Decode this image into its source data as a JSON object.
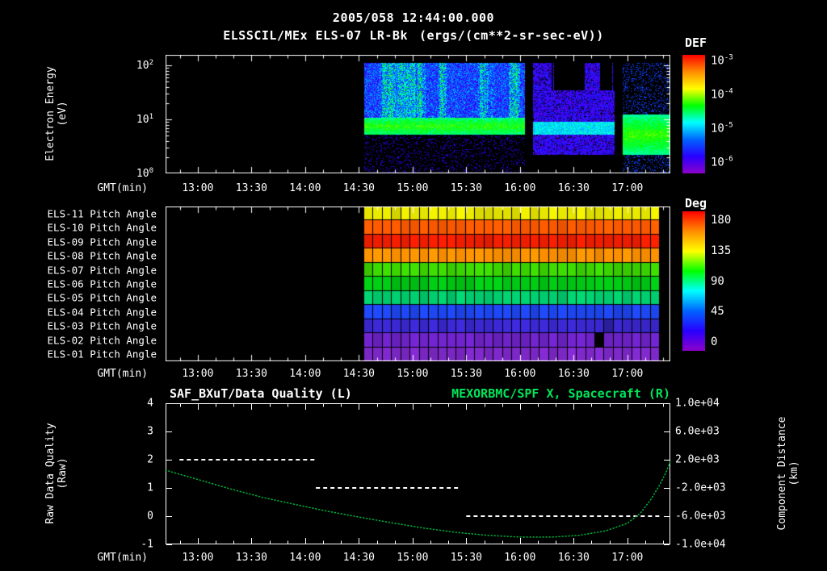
{
  "colors": {
    "background": "#000000",
    "text": "#ffffff",
    "accent_green": "#00e65a",
    "curve_green": "#00a838",
    "quality_white": "#ffffff",
    "rainbow": [
      "#ff0000",
      "#ff8c00",
      "#ffff00",
      "#00ff00",
      "#00ffff",
      "#0064ff",
      "#2800ff",
      "#8c00c8"
    ]
  },
  "header": {
    "timestamp": "2005/058 12:44:00.000",
    "instrument": "ELSSCIL/MEx ELS-07 LR-Bk",
    "units": "(ergs/(cm**2-sr-sec-eV))"
  },
  "time_axis": {
    "label": "GMT(min)",
    "start_hour": 12.7,
    "end_hour": 17.4,
    "ticks": [
      {
        "label": "13:00",
        "hour": 13.0
      },
      {
        "label": "13:30",
        "hour": 13.5
      },
      {
        "label": "14:00",
        "hour": 14.0
      },
      {
        "label": "14:30",
        "hour": 14.5
      },
      {
        "label": "15:00",
        "hour": 15.0
      },
      {
        "label": "15:30",
        "hour": 15.5
      },
      {
        "label": "16:00",
        "hour": 16.0
      },
      {
        "label": "16:30",
        "hour": 16.5
      },
      {
        "label": "17:00",
        "hour": 17.0
      }
    ],
    "minor_step_min": 10
  },
  "spectrogram_panel": {
    "ylabel": [
      "Electron Energy",
      "(eV)"
    ],
    "top_logE": 2.2,
    "yticks": [
      {
        "base": "10",
        "exp": "2",
        "logE": 2
      },
      {
        "base": "10",
        "exp": "1",
        "logE": 1
      },
      {
        "base": "10",
        "exp": "0",
        "logE": 0
      }
    ],
    "colorbar": {
      "title": "DEF",
      "ticks": [
        {
          "base": "10",
          "exp": "-3"
        },
        {
          "base": "10",
          "exp": "-4"
        },
        {
          "base": "10",
          "exp": "-5"
        },
        {
          "base": "10",
          "exp": "-6"
        }
      ]
    }
  },
  "pitch_panel": {
    "columns": 32,
    "data_start_hour": 14.55,
    "data_end_hour": 17.3,
    "rows": [
      {
        "label": "ELS-11 Pitch Angle",
        "color": "#e6e600",
        "deg": 125
      },
      {
        "label": "ELS-10 Pitch Angle",
        "color": "#ff5a00",
        "deg": 155
      },
      {
        "label": "ELS-09 Pitch Angle",
        "color": "#f01e00",
        "deg": 168
      },
      {
        "label": "ELS-08 Pitch Angle",
        "color": "#ff9100",
        "deg": 142
      },
      {
        "label": "ELS-07 Pitch Angle",
        "color": "#3cd400",
        "deg": 98
      },
      {
        "label": "ELS-06 Pitch Angle",
        "color": "#00c814",
        "deg": 88
      },
      {
        "label": "ELS-05 Pitch Angle",
        "color": "#00cd6e",
        "deg": 72
      },
      {
        "label": "ELS-04 Pitch Angle",
        "color": "#1e46f0",
        "deg": 48
      },
      {
        "label": "ELS-03 Pitch Angle",
        "color": "#3c28d2",
        "deg": 32
      },
      {
        "label": "ELS-02 Pitch Angle",
        "color": "#6e23c8",
        "deg": 18
      },
      {
        "label": "ELS-01 Pitch Angle",
        "color": "#7d28c8",
        "deg": 12
      }
    ],
    "special_cells": [
      {
        "row": 9,
        "col": 25,
        "color": "#000000"
      },
      {
        "row": 8,
        "col": 26,
        "color": "#2a1e9b"
      }
    ],
    "colorbar": {
      "title": "Deg",
      "ticks": [
        "180",
        "135",
        "90",
        "45",
        "0"
      ]
    }
  },
  "bottom_panel": {
    "title_left": "SAF_BXuT/Data Quality (L)",
    "title_right": "MEXORBMC/SPF X, Spacecraft (R)",
    "ylabel_left": [
      "Raw Data Quality",
      "(Raw)"
    ],
    "ylabel_right": [
      "Component Distance",
      "(km)"
    ],
    "yticks_left": [
      "4",
      "3",
      "2",
      "1",
      "0",
      "-1"
    ],
    "yticks_right": [
      "1.0e+04",
      "6.0e+03",
      "2.0e+03",
      "-2.0e+03",
      "-6.0e+03",
      "-1.0e+04"
    ],
    "y_range": [
      -1,
      4
    ]
  },
  "chart_data": [
    {
      "type": "heatmap",
      "name": "electron-energy-spectrogram",
      "title": "ELSSCIL/MEx ELS-07 LR-Bk",
      "units": "ergs/(cm**2-sr-sec-eV)",
      "xlabel": "GMT(min)",
      "x_ticks": [
        "13:00",
        "13:30",
        "14:00",
        "14:30",
        "15:00",
        "15:30",
        "16:00",
        "16:30",
        "17:00"
      ],
      "x_range_hours": [
        12.7,
        17.4
      ],
      "ylabel": "Electron Energy (eV)",
      "y_scale": "log",
      "y_range_eV": [
        1,
        160
      ],
      "colorbar": {
        "label": "DEF",
        "min": 1e-06,
        "max": 0.001
      },
      "data_start_hour": 14.55,
      "features": {
        "band_logE": [
          0.72,
          1.04
        ],
        "band_bright_until_hour": 16.04,
        "dim_zone_hours": [
          16.12,
          16.88
        ],
        "gaps_hours": [
          [
            16.04,
            16.12
          ],
          [
            16.88,
            16.95
          ]
        ],
        "right_blob": {
          "from_hour": 16.95,
          "logE": [
            0.35,
            1.1
          ]
        },
        "description": "No data before ~14:33. Diffuse blue 10-100 eV flux with bright cyan vertical bursts 14:33-16:00, persistent bright green band near 5-10 eV, faint purple flux with black dropouts 16:05-16:55, bright green patch ~3-13 eV after ~16:55 to end."
      }
    },
    {
      "type": "heatmap",
      "name": "pitch-angle-grid",
      "x_range_hours": [
        14.55,
        17.3
      ],
      "rows": [
        "ELS-11",
        "ELS-10",
        "ELS-09",
        "ELS-08",
        "ELS-07",
        "ELS-06",
        "ELS-05",
        "ELS-04",
        "ELS-03",
        "ELS-02",
        "ELS-01"
      ],
      "values_deg": [
        125,
        155,
        168,
        142,
        98,
        88,
        72,
        48,
        32,
        18,
        12
      ],
      "colorbar": {
        "label": "Deg",
        "min": 0,
        "max": 180
      },
      "anomalies": [
        {
          "sensor": "ELS-02",
          "hour": 16.95,
          "note": "black (missing) cell"
        }
      ]
    },
    {
      "type": "line",
      "name": "data-quality-and-spacecraft-x",
      "left_axis": {
        "label": "Raw Data Quality (Raw)",
        "range": [
          -1,
          4
        ]
      },
      "right_axis": {
        "label": "Component Distance (km)",
        "range": [
          -10000,
          10000
        ]
      },
      "series": [
        {
          "name": "SAF_BXuT/Data Quality (L)",
          "axis": "left",
          "style": "dashed-white",
          "segments": [
            {
              "hours": [
                12.83,
                14.1
              ],
              "value": 2
            },
            {
              "hours": [
                14.1,
                15.45
              ],
              "value": 1
            },
            {
              "hours": [
                15.5,
                17.3
              ],
              "value": 0
            }
          ]
        },
        {
          "name": "MEXORBMC/SPF X, Spacecraft (R)",
          "axis": "right",
          "style": "dotted-green",
          "right_axis_km_from_raw": "km = raw*4000 - 6000",
          "points_hour_raw": [
            [
              12.7,
              1.63
            ],
            [
              13.0,
              1.3
            ],
            [
              13.3,
              0.97
            ],
            [
              13.6,
              0.67
            ],
            [
              13.9,
              0.42
            ],
            [
              14.2,
              0.18
            ],
            [
              14.5,
              -0.03
            ],
            [
              14.8,
              -0.23
            ],
            [
              15.1,
              -0.42
            ],
            [
              15.4,
              -0.57
            ],
            [
              15.7,
              -0.68
            ],
            [
              16.0,
              -0.74
            ],
            [
              16.3,
              -0.74
            ],
            [
              16.55,
              -0.68
            ],
            [
              16.8,
              -0.52
            ],
            [
              17.0,
              -0.25
            ],
            [
              17.12,
              0.1
            ],
            [
              17.22,
              0.6
            ],
            [
              17.3,
              1.1
            ],
            [
              17.36,
              1.55
            ],
            [
              17.4,
              1.95
            ]
          ]
        }
      ]
    }
  ]
}
